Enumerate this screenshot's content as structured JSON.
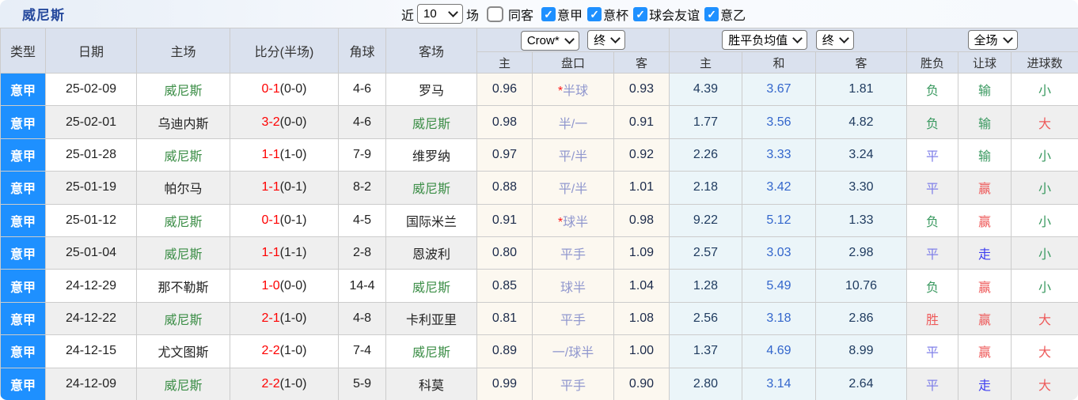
{
  "page": {
    "title": "威尼斯"
  },
  "filters": {
    "recent_label": "近",
    "recent_value": "10",
    "games_label": "场",
    "same_away": {
      "label": "同客",
      "checked": false
    },
    "leagues": [
      {
        "label": "意甲",
        "checked": true
      },
      {
        "label": "意杯",
        "checked": true
      },
      {
        "label": "球会友谊",
        "checked": true
      },
      {
        "label": "意乙",
        "checked": true
      }
    ]
  },
  "table": {
    "team": "威尼斯",
    "static_headers": [
      "类型",
      "日期",
      "主场",
      "比分(半场)",
      "角球",
      "客场"
    ],
    "groups": [
      {
        "select1": "Crow*",
        "select2": "终",
        "subs": [
          "主",
          "盘口",
          "客"
        ]
      },
      {
        "select1": "胜平负均值",
        "select2": "终",
        "subs": [
          "主",
          "和",
          "客"
        ]
      },
      {
        "select1": "全场",
        "subs": [
          "胜负",
          "让球",
          "进球数"
        ]
      }
    ],
    "rows": [
      {
        "league": "意甲",
        "date": "25-02-09",
        "home": "威尼斯",
        "score": "0-1",
        "half": "(0-0)",
        "corner": "4-6",
        "away": "罗马",
        "o1": "0.96",
        "pan": "*半球",
        "o2": "0.93",
        "a1": "4.39",
        "a2": "3.67",
        "a3": "1.81",
        "r1": "负",
        "r2": "输",
        "r3": "小"
      },
      {
        "league": "意甲",
        "date": "25-02-01",
        "home": "乌迪内斯",
        "score": "3-2",
        "half": "(0-0)",
        "corner": "4-6",
        "away": "威尼斯",
        "o1": "0.98",
        "pan": "半/一",
        "o2": "0.91",
        "a1": "1.77",
        "a2": "3.56",
        "a3": "4.82",
        "r1": "负",
        "r2": "输",
        "r3": "大"
      },
      {
        "league": "意甲",
        "date": "25-01-28",
        "home": "威尼斯",
        "score": "1-1",
        "half": "(1-0)",
        "corner": "7-9",
        "away": "维罗纳",
        "o1": "0.97",
        "pan": "平/半",
        "o2": "0.92",
        "a1": "2.26",
        "a2": "3.33",
        "a3": "3.24",
        "r1": "平",
        "r2": "输",
        "r3": "小"
      },
      {
        "league": "意甲",
        "date": "25-01-19",
        "home": "帕尔马",
        "score": "1-1",
        "half": "(0-1)",
        "corner": "8-2",
        "away": "威尼斯",
        "o1": "0.88",
        "pan": "平/半",
        "o2": "1.01",
        "a1": "2.18",
        "a2": "3.42",
        "a3": "3.30",
        "r1": "平",
        "r2": "赢",
        "r3": "小"
      },
      {
        "league": "意甲",
        "date": "25-01-12",
        "home": "威尼斯",
        "score": "0-1",
        "half": "(0-1)",
        "corner": "4-5",
        "away": "国际米兰",
        "o1": "0.91",
        "pan": "*球半",
        "o2": "0.98",
        "a1": "9.22",
        "a2": "5.12",
        "a3": "1.33",
        "r1": "负",
        "r2": "赢",
        "r3": "小"
      },
      {
        "league": "意甲",
        "date": "25-01-04",
        "home": "威尼斯",
        "score": "1-1",
        "half": "(1-1)",
        "corner": "2-8",
        "away": "恩波利",
        "o1": "0.80",
        "pan": "平手",
        "o2": "1.09",
        "a1": "2.57",
        "a2": "3.03",
        "a3": "2.98",
        "r1": "平",
        "r2": "走",
        "r3": "小"
      },
      {
        "league": "意甲",
        "date": "24-12-29",
        "home": "那不勒斯",
        "score": "1-0",
        "half": "(0-0)",
        "corner": "14-4",
        "away": "威尼斯",
        "o1": "0.85",
        "pan": "球半",
        "o2": "1.04",
        "a1": "1.28",
        "a2": "5.49",
        "a3": "10.76",
        "r1": "负",
        "r2": "赢",
        "r3": "小"
      },
      {
        "league": "意甲",
        "date": "24-12-22",
        "home": "威尼斯",
        "score": "2-1",
        "half": "(1-0)",
        "corner": "4-8",
        "away": "卡利亚里",
        "o1": "0.81",
        "pan": "平手",
        "o2": "1.08",
        "a1": "2.56",
        "a2": "3.18",
        "a3": "2.86",
        "r1": "胜",
        "r2": "赢",
        "r3": "大"
      },
      {
        "league": "意甲",
        "date": "24-12-15",
        "home": "尤文图斯",
        "score": "2-2",
        "half": "(1-0)",
        "corner": "7-4",
        "away": "威尼斯",
        "o1": "0.89",
        "pan": "一/球半",
        "o2": "1.00",
        "a1": "1.37",
        "a2": "4.69",
        "a3": "8.99",
        "r1": "平",
        "r2": "赢",
        "r3": "大"
      },
      {
        "league": "意甲",
        "date": "24-12-09",
        "home": "威尼斯",
        "score": "2-2",
        "half": "(1-0)",
        "corner": "5-9",
        "away": "科莫",
        "o1": "0.99",
        "pan": "平手",
        "o2": "0.90",
        "a1": "2.80",
        "a2": "3.14",
        "a3": "2.64",
        "r1": "平",
        "r2": "走",
        "r3": "大"
      }
    ]
  },
  "colors": {
    "accent_blue": "#1e90ff",
    "header_bg": "#dae1ee",
    "team_green": "#3c8e47",
    "score_red": "#fe0000",
    "handicap_purple": "#9097ce",
    "odds_bg_cream": "#fcf8f0",
    "avg_bg_blue": "#ebf5f9",
    "avg_mid_blue": "#3366cc",
    "win_red": "#ee5a5a",
    "draw_violet": "#7f7fe8",
    "lose_green": "#3a9960",
    "push_blue": "#3c3cf0"
  }
}
